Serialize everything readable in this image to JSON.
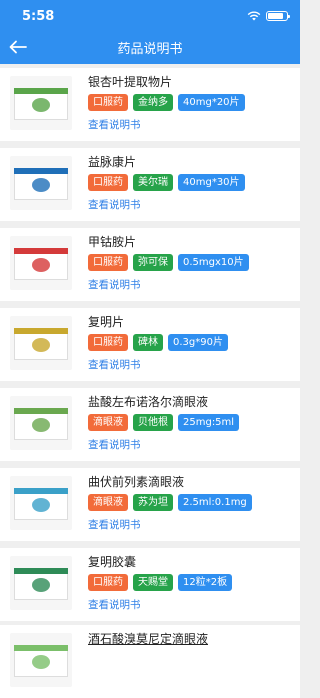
{
  "status": {
    "time": "5:58",
    "battery_level": 0.85
  },
  "header": {
    "title": "药品说明书"
  },
  "icons": {
    "back": "arrow-left-icon",
    "wifi": "wifi-icon",
    "battery": "battery-icon"
  },
  "colors": {
    "primary": "#2f8ff0",
    "route_tag": "#f26b3a",
    "brand_tag": "#27a34a",
    "spec_tag": "#2f8ff0",
    "link": "#2f7fe6"
  },
  "drugs": [
    {
      "name": "银杏叶提取物片",
      "route": "口服药",
      "brand": "金纳多",
      "spec": "40mg*20片",
      "link": "查看说明书",
      "thumb_color": "#5aa54a"
    },
    {
      "name": "益脉康片",
      "route": "口服药",
      "brand": "美尔瑞",
      "spec": "40mg*30片",
      "link": "查看说明书",
      "thumb_color": "#1f6fb8"
    },
    {
      "name": "甲钴胺片",
      "route": "口服药",
      "brand": "弥可保",
      "spec": "0.5mgx10片",
      "link": "查看说明书",
      "thumb_color": "#d43a3a"
    },
    {
      "name": "复明片",
      "route": "口服药",
      "brand": "碑林",
      "spec": "0.3g*90片",
      "link": "查看说明书",
      "thumb_color": "#c8a82e"
    },
    {
      "name": "盐酸左布诺洛尔滴眼液",
      "route": "滴眼液",
      "brand": "贝他根",
      "spec": "25mg:5ml",
      "link": "查看说明书",
      "thumb_color": "#6aa84f"
    },
    {
      "name": "曲伏前列素滴眼液",
      "route": "滴眼液",
      "brand": "苏为坦",
      "spec": "2.5ml:0.1mg",
      "link": "查看说明书",
      "thumb_color": "#3aa0c8"
    },
    {
      "name": "复明胶囊",
      "route": "口服药",
      "brand": "天赐堂",
      "spec": "12粒*2板",
      "link": "查看说明书",
      "thumb_color": "#2e8b57"
    },
    {
      "name": "酒石酸溴莫尼定滴眼液",
      "route": "",
      "brand": "",
      "spec": "",
      "link": "",
      "thumb_color": "#7bbf6a"
    }
  ]
}
